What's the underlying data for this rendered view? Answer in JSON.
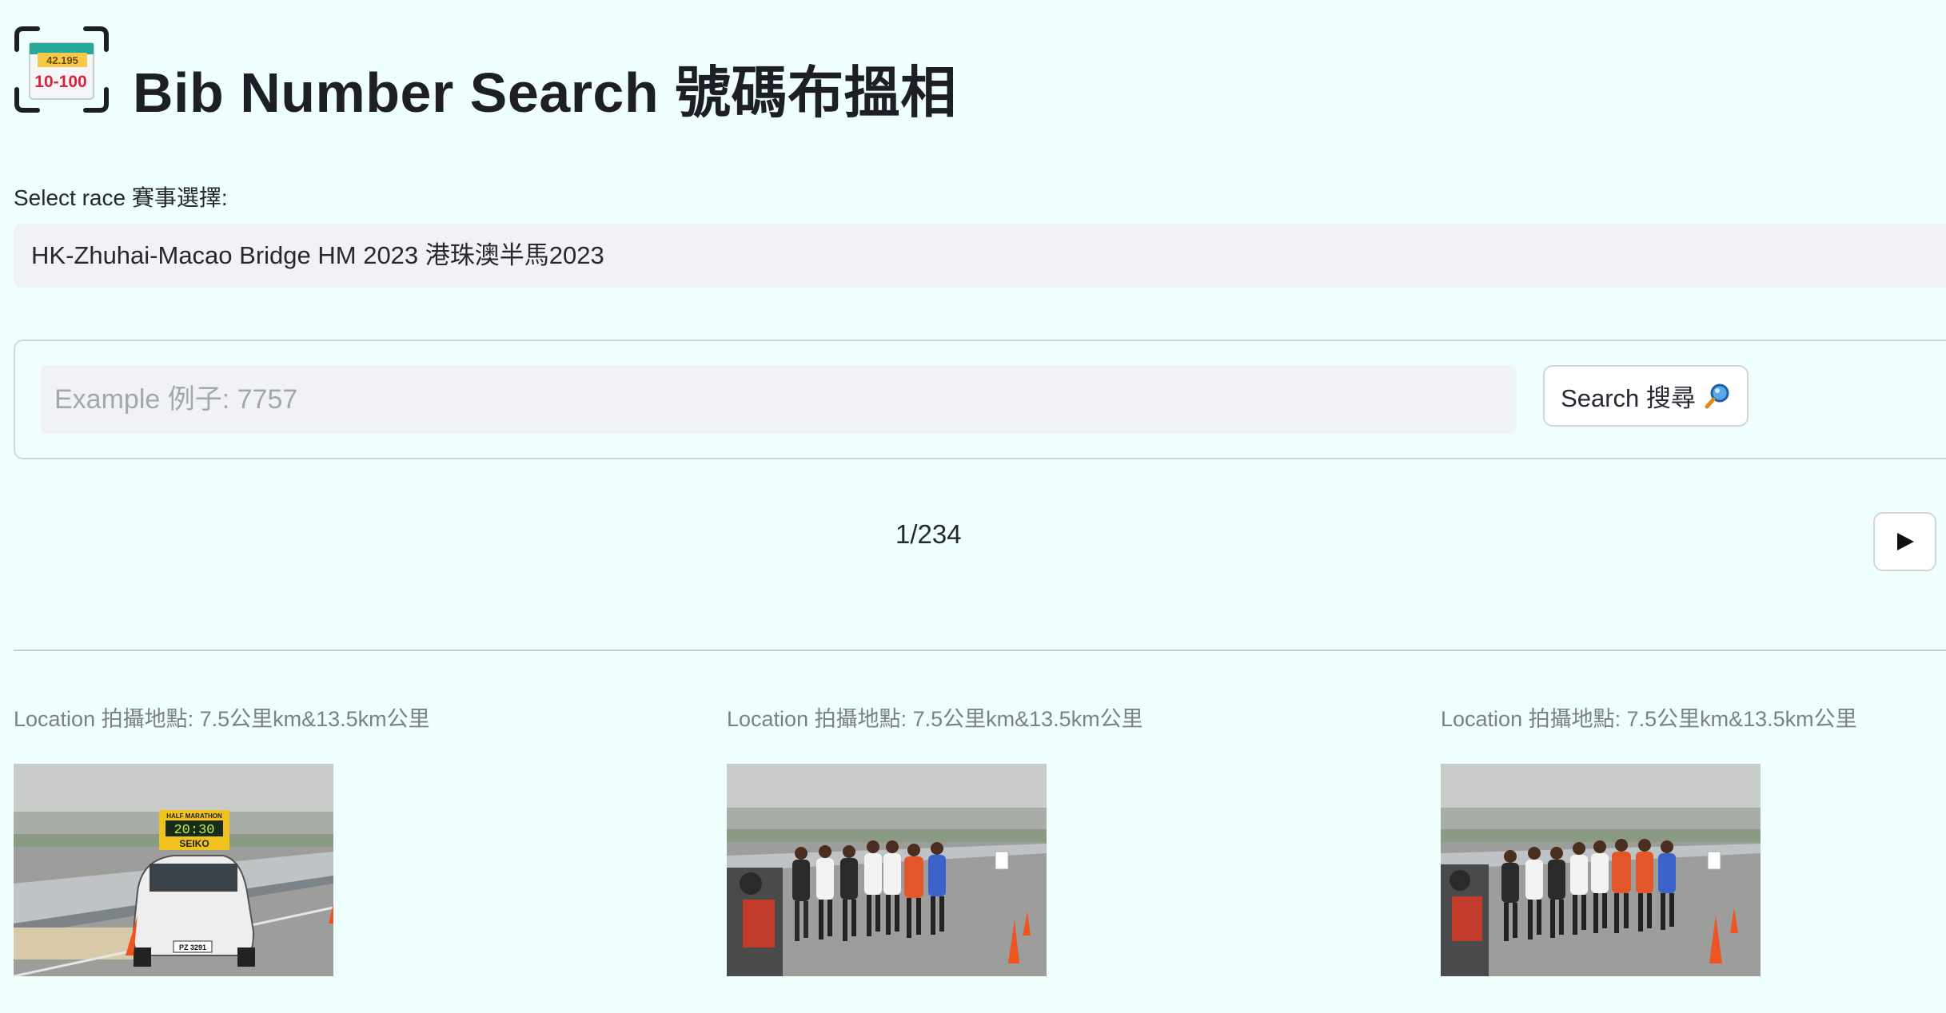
{
  "header": {
    "logo_top_text": "42.195",
    "logo_bottom_text": "10-100",
    "title": "Bib Number Search 號碼布搵相"
  },
  "race_select": {
    "label": "Select race 賽事選擇:",
    "value": "HK-Zhuhai-Macao Bridge HM 2023 港珠澳半馬2023"
  },
  "search": {
    "placeholder": "Example 例子: 7757",
    "button_label": "Search 搜尋",
    "button_icon": "magnifying-glass-icon"
  },
  "pagination": {
    "counter": "1/234",
    "next_icon": "play-triangle-icon"
  },
  "photos": [
    {
      "caption": "Location 拍攝地點: 7.5公里km&13.5km公里",
      "sign_top": "HALF MARATHON",
      "clock": "20:30",
      "brand": "SEIKO",
      "plate": "PZ 3291"
    },
    {
      "caption": "Location 拍攝地點: 7.5公里km&13.5km公里"
    },
    {
      "caption": "Location 拍攝地點: 7.5公里km&13.5km公里"
    }
  ],
  "colors": {
    "background": "#effffd",
    "input_bg": "#f0f2f6",
    "caption_text": "#7d8087",
    "runner_orange": "#e2572a",
    "runner_blue": "#3b63c9"
  }
}
